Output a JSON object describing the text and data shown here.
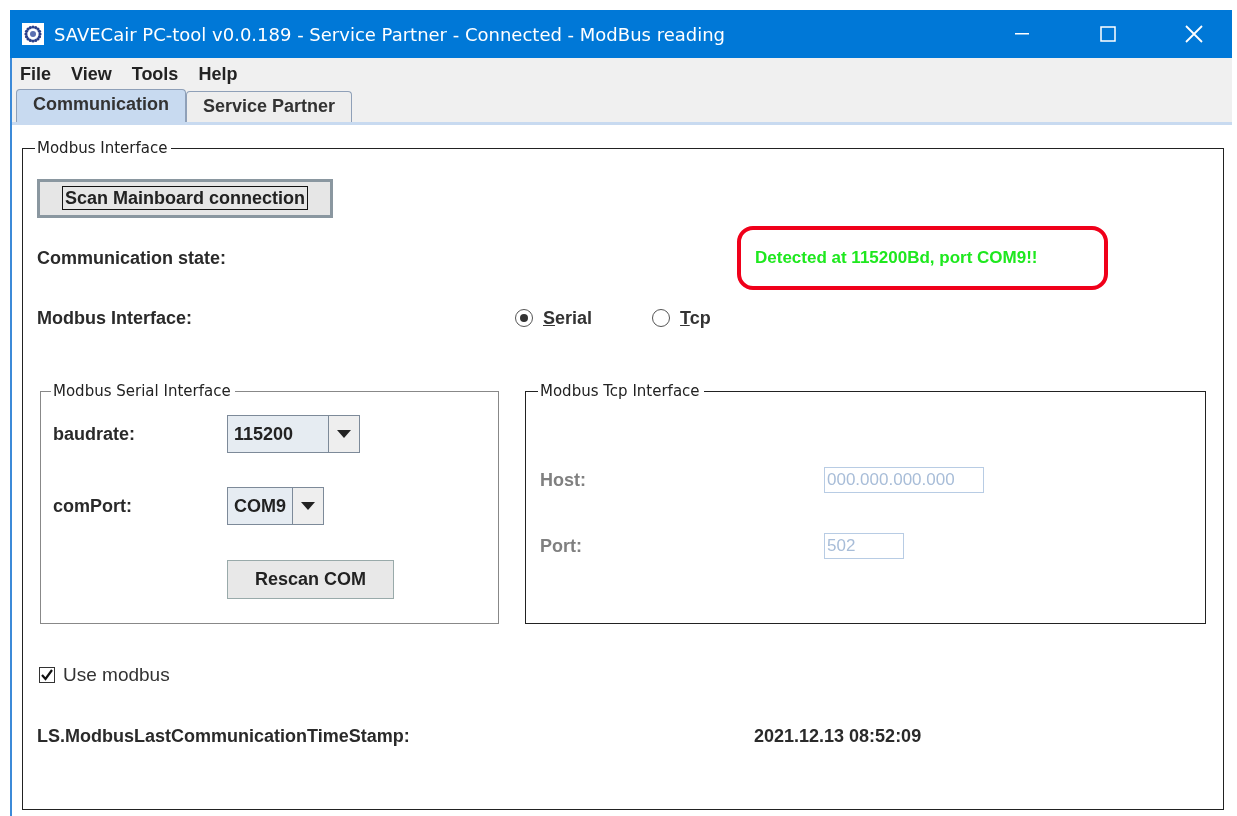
{
  "window": {
    "title": "SAVECair PC-tool v0.0.189 - Service Partner - Connected - ModBus reading"
  },
  "menu": [
    "File",
    "View",
    "Tools",
    "Help"
  ],
  "tabs": [
    {
      "label": "Communication",
      "selected": true
    },
    {
      "label": "Service Partner",
      "selected": false
    }
  ],
  "modbus_interface": {
    "title": "Modbus Interface",
    "scan_button": "Scan Mainboard connection",
    "communication_state": {
      "label": "Communication state:",
      "value": "Detected at 115200Bd, port COM9!!",
      "highlighted": true
    },
    "interface": {
      "label": "Modbus Interface:",
      "options": [
        {
          "label": "Serial",
          "selected": true
        },
        {
          "label": "Tcp",
          "selected": false
        }
      ]
    },
    "serial_interface": {
      "title": "Modbus Serial Interface",
      "baudrate": {
        "label": "baudrate:",
        "value": "115200"
      },
      "com_port": {
        "label": "comPort:",
        "value": "COM9"
      },
      "rescan_button": "Rescan COM"
    },
    "tcp_interface": {
      "title": "Modbus Tcp Interface",
      "disabled": true,
      "host": {
        "label": "Host:",
        "value": "000.000.000.000"
      },
      "port": {
        "label": "Port:",
        "value": "502"
      }
    },
    "use_modbus": {
      "label": "Use modbus",
      "checked": true
    },
    "timestamp": {
      "label": "LS.ModbusLastCommunicationTimeStamp:",
      "value": "2021.12.13 08:52:09"
    }
  }
}
